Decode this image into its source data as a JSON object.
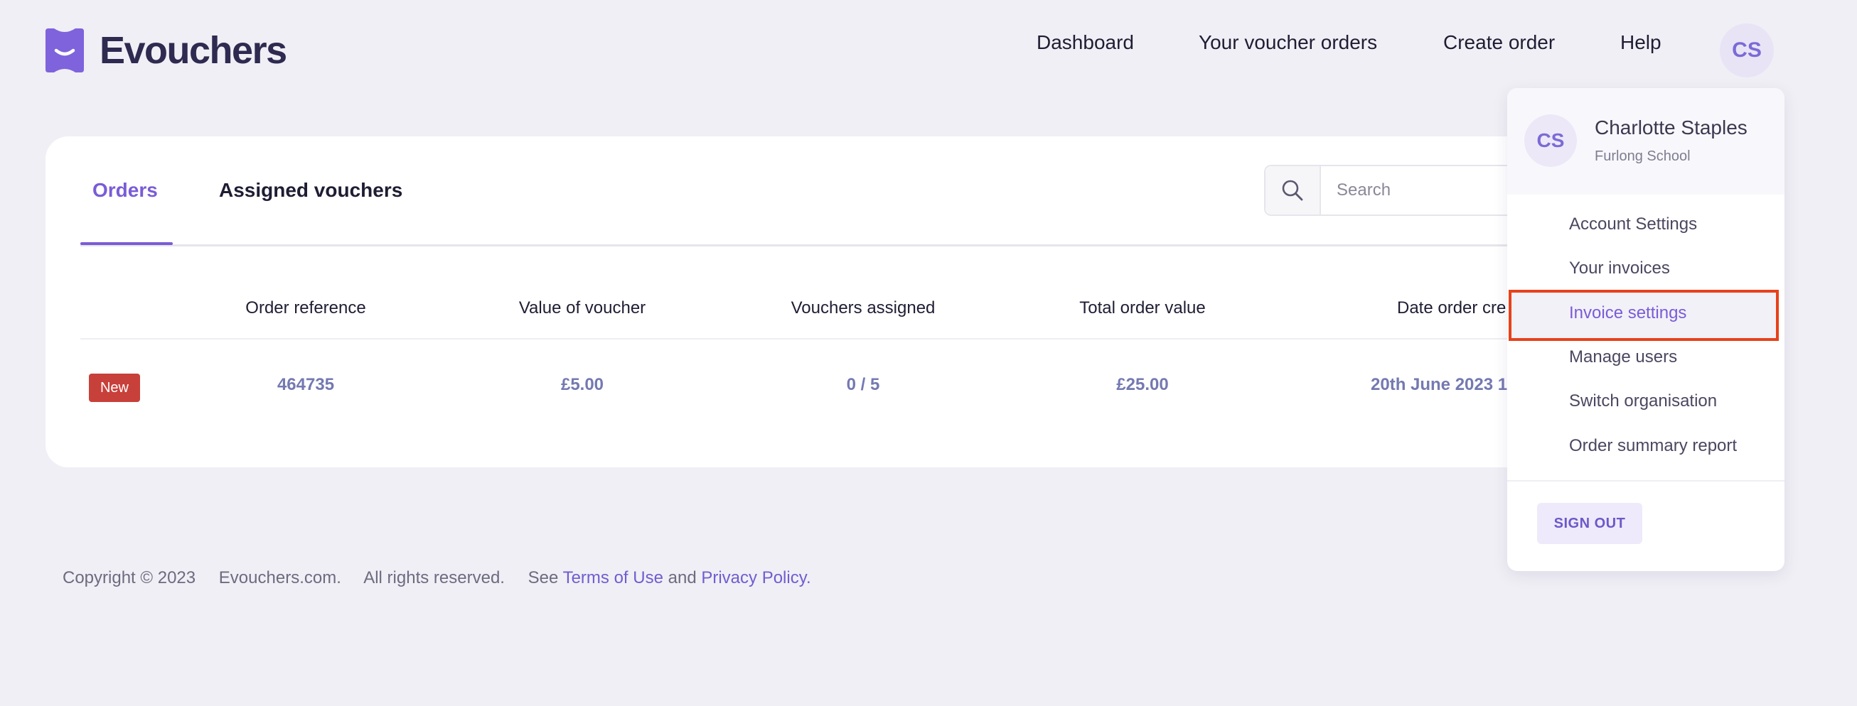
{
  "brand": {
    "name": "Evouchers"
  },
  "nav": {
    "dashboard": "Dashboard",
    "orders": "Your voucher orders",
    "create": "Create order",
    "help": "Help",
    "avatar_initials": "CS"
  },
  "tabs": {
    "orders": "Orders",
    "assigned": "Assigned vouchers"
  },
  "search": {
    "placeholder": "Search"
  },
  "table": {
    "headers": {
      "reference": "Order reference",
      "value": "Value of voucher",
      "assigned": "Vouchers assigned",
      "total": "Total order value",
      "date": "Date order cre"
    },
    "row": {
      "badge": "New",
      "reference": "464735",
      "value": "£5.00",
      "assigned": "0 / 5",
      "total": "£25.00",
      "date": "20th June 2023 1"
    }
  },
  "footer": {
    "copyright": "Copyright © 2023",
    "site": "Evouchers.com.",
    "rights": "All rights reserved.",
    "see": "See",
    "terms": "Terms of Use",
    "and": "and",
    "privacy": "Privacy Policy",
    "period": "."
  },
  "menu": {
    "initials": "CS",
    "name": "Charlotte Staples",
    "organisation": "Furlong School",
    "items": [
      "Account Settings",
      "Your invoices",
      "Invoice settings",
      "Manage users",
      "Switch organisation",
      "Order summary report"
    ],
    "signout": "SIGN OUT"
  },
  "colors": {
    "accent": "#7a5cd6",
    "highlight_border": "#e8411a",
    "badge": "#c8403a",
    "background": "#f0eff5"
  }
}
